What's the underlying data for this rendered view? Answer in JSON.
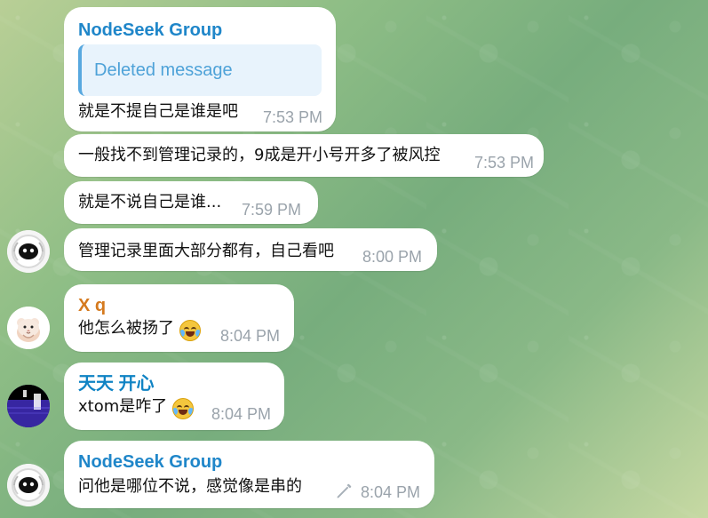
{
  "window": {
    "app_name": "Telegram"
  },
  "colors": {
    "sender_nodeseek": "#1f86c9",
    "sender_xq": "#d57a1f",
    "sender_tiantian": "#0f83c4",
    "quote_bar": "#58a8df",
    "quote_bg": "#e8f3fc",
    "time_text": "#9aa3ab"
  },
  "messages": [
    {
      "sender": "NodeSeek Group",
      "quote": "Deleted message",
      "text": "就是不提自己是谁是吧",
      "time": "7:53 PM"
    },
    {
      "text": "一般找不到管理记录的，9成是开小号开多了被风控",
      "time": "7:53 PM"
    },
    {
      "text": "就是不说自己是谁...",
      "time": "7:59 PM"
    },
    {
      "text": "管理记录里面大部分都有，自己看吧",
      "time": "8:00 PM"
    },
    {
      "sender": "X q",
      "text": "他怎么被扬了",
      "time": "8:04 PM"
    },
    {
      "sender": "天天 开心",
      "text": "xtom是咋了",
      "time": "8:04 PM"
    },
    {
      "sender": "NodeSeek Group",
      "text": "问他是哪位不说，感觉像是串的",
      "time": "8:04 PM"
    }
  ]
}
